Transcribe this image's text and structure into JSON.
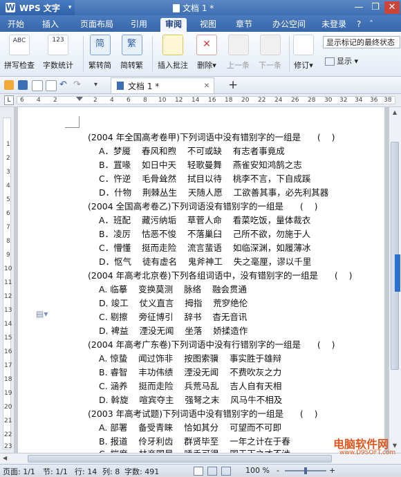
{
  "titlebar": {
    "app_name": "WPS 文字",
    "document_title": "文档 1 *",
    "minimize": "—",
    "restore": "❐",
    "close": "✕"
  },
  "tabs": [
    "开始",
    "插入",
    "页面布局",
    "引用",
    "审阅",
    "视图",
    "章节",
    "办公空间"
  ],
  "active_tab": "审阅",
  "login": "未登录",
  "ribbon": {
    "spell_check": "拼写检查",
    "word_count": "字数统计",
    "to_simplified": "繁转简",
    "to_traditional": "简转繁",
    "insert_comment": "插入批注",
    "delete": "删除",
    "prev": "上一条",
    "next": "下一条",
    "track_changes": "修订",
    "show": "显示",
    "markup_select": "显示标记的最终状态",
    "icon_text_abc": "ABC",
    "icon_text_123": "123",
    "icon_text_jian": "简",
    "icon_text_fan": "繁",
    "dropdown_caret": "▾"
  },
  "doc_tab": {
    "label": "文档 1 *",
    "close": "✕",
    "new": "+"
  },
  "ruler": {
    "marker": "L",
    "numbers": [
      "6",
      "4",
      "2",
      "2",
      "4",
      "6",
      "8",
      "10",
      "12",
      "14",
      "16",
      "18",
      "20",
      "22",
      "24",
      "26",
      "28",
      "30",
      "32",
      "34",
      "36",
      "38"
    ],
    "vnumbers": [
      "1",
      "2",
      "3",
      "4",
      "5",
      "6",
      "7",
      "8",
      "9",
      "10",
      "11",
      "12",
      "13",
      "14",
      "15",
      "16",
      "17",
      "18",
      "19",
      "20",
      "21",
      "22",
      "23",
      "24"
    ]
  },
  "document_lines": [
    "(2004 年全国高考卷甲)下列词语中没有错别字的一组是      (    )",
    "A．梦魇    春风和煦    不可或缺    有志者事竟成",
    "B．罝喙    如日中天    轻歌曼舞    燕雀安知鸿鹄之志",
    "C．忤逆    毛骨耸然    拭目以待    桃李不言，下自成蹊",
    "D．什物    荆棘丛生    天随人愿    工欲善其事，必先利其器",
    "(2004 全国高考卷乙)下列词语没有错别字的一组是      (    )",
    "A．班配    藏污纳垢    草菅人命    看菜吃饭，量体裁衣",
    "B．凌厉    怙恶不悛    不落巢臼    己所不欲，勿施于人",
    "C．懵懂    挺而走险    流言蜚语    如临深渊，如履薄冰",
    "D．怄气    徒有虚名    鬼斧神工    失之毫厘，谬以千里",
    "(2004 年高考北京卷)下列各组词语中，没有错别字的一组是      (    )",
    "A. 临摹    变换莫测    脉络    融会贯通",
    "D. 竣工    仗义直言    拇指    荒穸绝伦",
    "C. 剔擦    旁征博引    辞书    杳无音讯",
    "D. 裨益    湮没无闻    坐落    娇揉造作",
    "(2004 年高考广东卷)下列词语中没有行错别字的一组是      (    )",
    "A. 惊蛰    闻过饰非    按图索骥    事实胜于雄辩",
    "B. 睿智    丰功伟绩    湮没无闻    不费吹灰之力",
    "C. 涵养    挺而走险    兵荒马乱    吉人自有天相",
    "D. 斡旋    喧宾夺主    强弩之末    风马牛不相及",
    "(2003 年高考试题)下列词语中没有错别字的一组是      (    )",
    "A. 部署    备受青睐    恰如其分    可望而不可即",
    "B. 报道    伶牙利齿    群贤毕至    一年之计在于春",
    "C. 揣度    林商国是    唾手可得    国王下之才不涉"
  ],
  "status": {
    "page": "页面: 1/1",
    "section": "节: 1/1",
    "row": "行: 14",
    "col": "列: 8",
    "chars": "字数: 491",
    "zoom": "100 %",
    "zoom_minus": "-",
    "zoom_plus": "+"
  },
  "watermark": {
    "brand": "电脑软件网",
    "url": "www.D9SOFT.com"
  },
  "colors": {
    "title_blue": "#3e6fb3",
    "accent_blue": "#2f6fd0",
    "watermark": "#e2551b"
  }
}
